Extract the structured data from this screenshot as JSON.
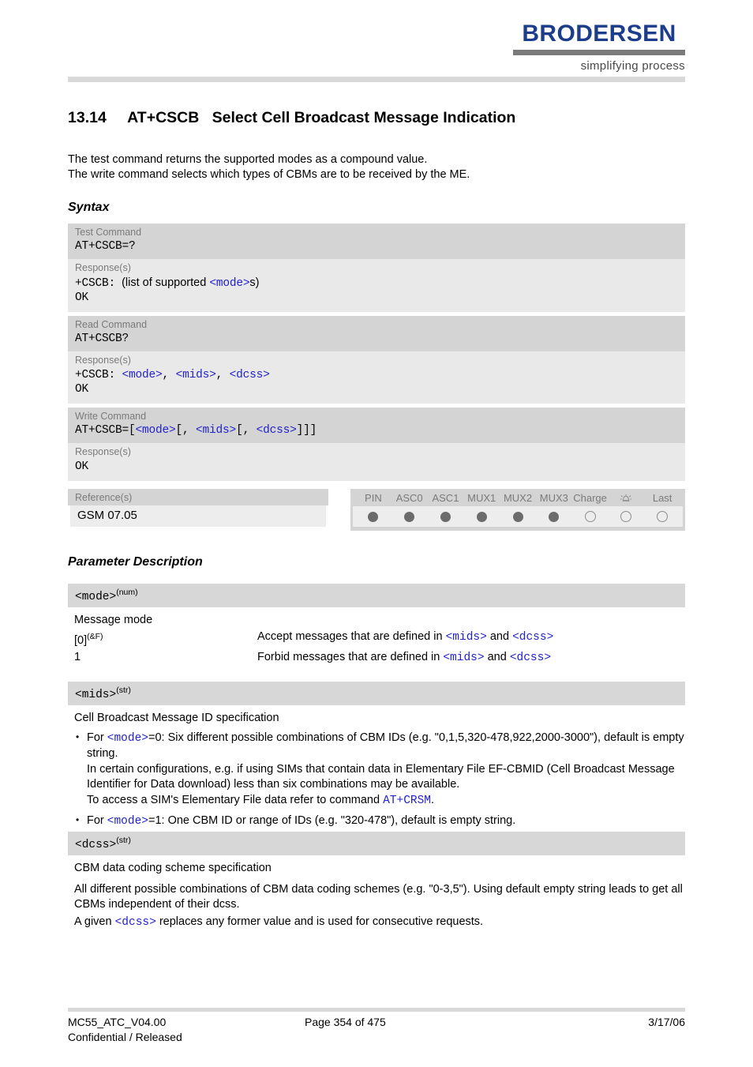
{
  "header": {
    "logo_word": "BRODERSEN",
    "logo_tagline": "simplifying process",
    "brand_color": "#1b3d8c"
  },
  "section": {
    "number": "13.14",
    "command": "AT+CSCB",
    "title": "Select Cell Broadcast Message Indication",
    "heading_full": "13.14     AT+CSCB   Select Cell Broadcast Message Indication"
  },
  "intro": {
    "line1": "The test command returns the supported modes as a compound value.",
    "line2": "The write command selects which types of CBMs are to be received by the ME."
  },
  "headings": {
    "syntax": "Syntax",
    "parameter_description": "Parameter Description"
  },
  "syntax": {
    "test": {
      "command_label": "Test Command",
      "command": "AT+CSCB=?",
      "response_label": "Response(s)",
      "response_prefix": "+CSCB:",
      "response_text_a": "(list of supported ",
      "response_param": "<mode>",
      "response_text_b": "s)",
      "response_ok": "OK"
    },
    "read": {
      "command_label": "Read Command",
      "command": "AT+CSCB?",
      "response_label": "Response(s)",
      "response_prefix": "+CSCB:",
      "p_mode": "<mode>",
      "p_mids": "<mids>",
      "p_dcss": "<dcss>",
      "response_ok": "OK"
    },
    "write": {
      "command_label": "Write Command",
      "command_prefix": "AT+CSCB=[",
      "p_mode": "<mode>",
      "sep1": "[, ",
      "p_mids": "<mids>",
      "sep2": "[, ",
      "p_dcss": "<dcss>",
      "sep3": "]]]",
      "response_label": "Response(s)",
      "response_ok": "OK"
    }
  },
  "reference": {
    "label": "Reference(s)",
    "value": "GSM 07.05"
  },
  "pin_table": {
    "columns": [
      "PIN",
      "ASC0",
      "ASC1",
      "MUX1",
      "MUX2",
      "MUX3",
      "Charge",
      "alarm-bell-icon",
      "Last"
    ],
    "states": [
      "filled",
      "filled",
      "filled",
      "filled",
      "filled",
      "filled",
      "empty",
      "empty",
      "empty"
    ],
    "filled_color": "#6b6b6b",
    "empty_border_color": "#8d8d8d"
  },
  "parameters": [
    {
      "name": "<mode>",
      "type": "(num)",
      "description": "Message mode",
      "values": [
        {
          "key": "[0]",
          "key_sup": "(&F)",
          "desc_a": "Accept messages that are defined in ",
          "p1": "<mids>",
          "desc_b": " and ",
          "p2": "<dcss>"
        },
        {
          "key": "1",
          "key_sup": "",
          "desc_a": "Forbid messages that are defined in ",
          "p1": "<mids>",
          "desc_b": " and ",
          "p2": "<dcss>"
        }
      ]
    },
    {
      "name": "<mids>",
      "type": "(str)",
      "description": "Cell Broadcast Message ID specification",
      "bullet1": {
        "t1": "For ",
        "p1": "<mode>",
        "t2": "=0: Six different possible combinations of CBM IDs (e.g. \"0,1,5,320-478,922,2000-3000\"), default is empty string.",
        "t3": "In certain configurations, e.g. if using SIMs that contain data in Elementary File EF-CBMID (Cell Broadcast Message Identifier for Data download) less than six combinations may be available.",
        "t4": "To access a SIM's Elementary File data refer to command ",
        "p2": "AT+CRSM",
        "t5": "."
      },
      "bullet2": {
        "t1": "For ",
        "p1": "<mode>",
        "t2": "=1: One CBM ID or range of IDs (e.g. \"320-478\"), default is empty string."
      }
    },
    {
      "name": "<dcss>",
      "type": "(str)",
      "description": "CBM data coding scheme specification",
      "para1": "All different possible combinations of CBM data coding schemes (e.g. \"0-3,5\"). Using default empty string leads to get all CBMs independent of their dcss.",
      "para2_a": "A given ",
      "para2_p": "<dcss>",
      "para2_b": " replaces any former value and is used for consecutive requests."
    }
  ],
  "footer": {
    "document": "MC55_ATC_V04.00",
    "classification": "Confidential / Released",
    "page": "Page 354 of 475",
    "date": "3/17/06"
  }
}
